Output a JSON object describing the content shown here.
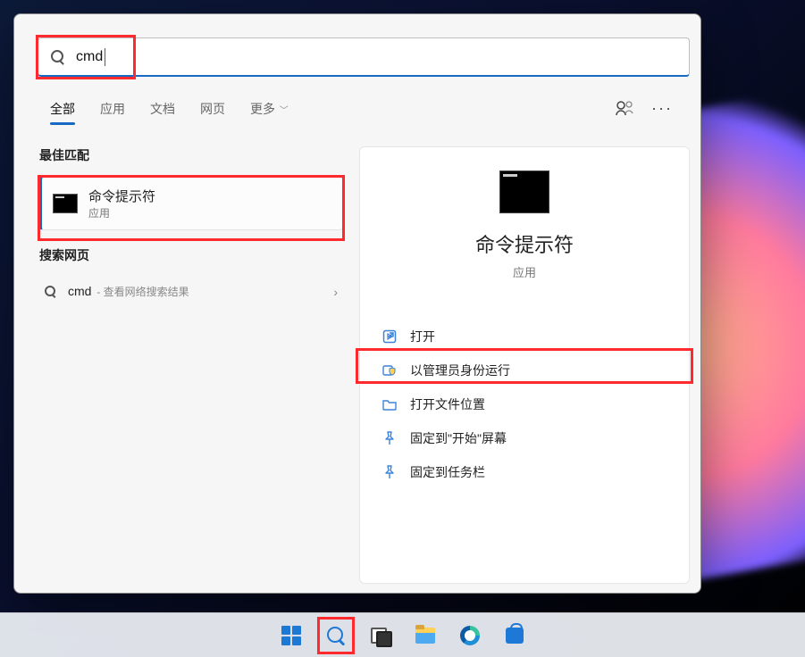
{
  "search": {
    "query": "cmd"
  },
  "tabs": [
    "全部",
    "应用",
    "文档",
    "网页",
    "更多"
  ],
  "sections": {
    "best_match": "最佳匹配",
    "web_search": "搜索网页"
  },
  "best_match_item": {
    "name": "命令提示符",
    "sub": "应用"
  },
  "web_item": {
    "term": "cmd",
    "hint": "- 查看网络搜索结果"
  },
  "detail": {
    "title": "命令提示符",
    "sub": "应用",
    "actions": [
      {
        "icon": "open",
        "label": "打开"
      },
      {
        "icon": "admin",
        "label": "以管理员身份运行"
      },
      {
        "icon": "folder",
        "label": "打开文件位置"
      },
      {
        "icon": "pin",
        "label": "固定到\"开始\"屏幕"
      },
      {
        "icon": "pin",
        "label": "固定到任务栏"
      }
    ]
  },
  "taskbar": {
    "items": [
      "start",
      "search",
      "taskview",
      "explorer",
      "edge",
      "store"
    ]
  }
}
